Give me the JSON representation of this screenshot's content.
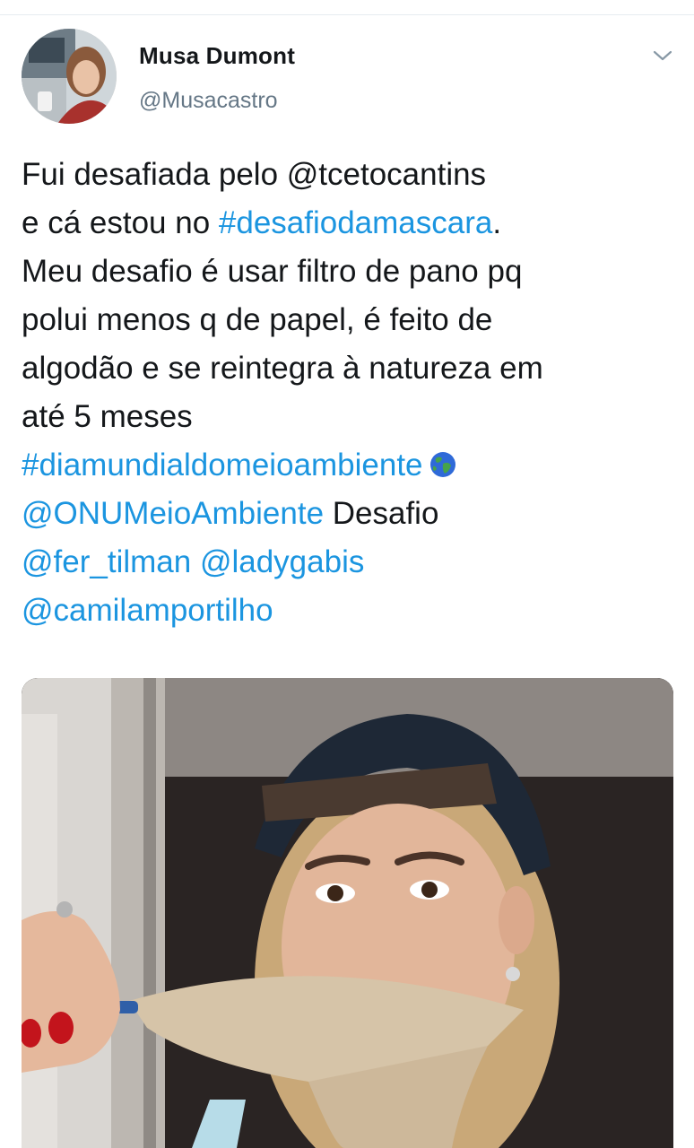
{
  "user": {
    "display_name": "Musa Dumont",
    "handle": "@Musacastro",
    "avatar_icon": "profile-photo"
  },
  "tweet": {
    "lines": [
      {
        "segments": [
          {
            "text": "Fui desafiada pelo @tcetocantins",
            "link": false
          }
        ]
      },
      {
        "segments": [
          {
            "text": "e cá estou no ",
            "link": false
          },
          {
            "text": "#desafiodamascara",
            "link": true
          },
          {
            "text": ".",
            "link": false
          }
        ]
      },
      {
        "segments": [
          {
            "text": "Meu desafio é usar filtro de pano pq",
            "link": false
          }
        ]
      },
      {
        "segments": [
          {
            "text": "polui menos q de papel, é feito de",
            "link": false
          }
        ]
      },
      {
        "segments": [
          {
            "text": "algodão e se reintegra à natureza em",
            "link": false
          }
        ]
      },
      {
        "segments": [
          {
            "text": "até 5 meses",
            "link": false
          }
        ]
      },
      {
        "segments": [
          {
            "text": "#diamundialdomeioambiente",
            "link": true
          }
        ],
        "emoji": "earth-globe-icon"
      },
      {
        "segments": [
          {
            "text": "@ONUMeioAmbiente",
            "link": true
          },
          {
            "text": " Desafio",
            "link": false
          }
        ]
      },
      {
        "segments": [
          {
            "text": "@fer_tilman",
            "link": true
          },
          {
            "text": " ",
            "link": false
          },
          {
            "text": "@ladygabis",
            "link": true
          }
        ]
      },
      {
        "segments": [
          {
            "text": "@camilamportilho",
            "link": true
          }
        ]
      }
    ]
  },
  "media": {
    "description_icon": "tweet-photo"
  },
  "colors": {
    "link": "#1b95e0",
    "text": "#14171a",
    "secondary": "#657786"
  }
}
